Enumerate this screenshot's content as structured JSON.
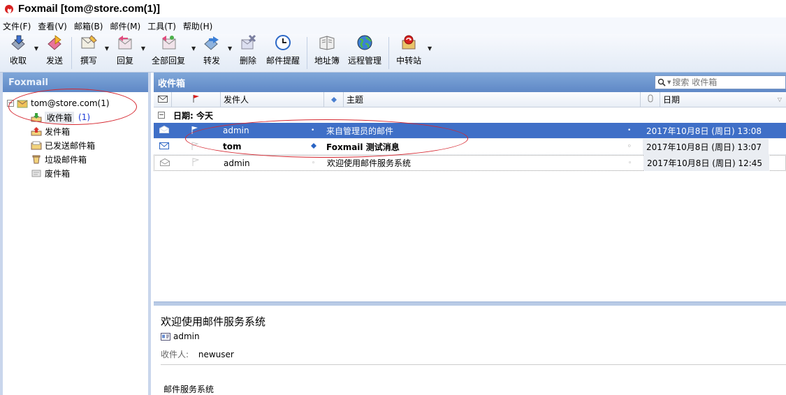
{
  "window": {
    "title": "Foxmail [tom@store.com(1)]"
  },
  "menu": [
    "文件(F)",
    "查看(V)",
    "邮箱(B)",
    "邮件(M)",
    "工具(T)",
    "帮助(H)"
  ],
  "toolbar": {
    "receive": "收取",
    "send": "发送",
    "compose": "撰写",
    "reply": "回复",
    "reply_all": "全部回复",
    "forward": "转发",
    "delete": "删除",
    "reminder": "邮件提醒",
    "address_book": "地址簿",
    "remote_manage": "远程管理",
    "relay": "中转站"
  },
  "sidebar": {
    "header": "Foxmail",
    "account": "tom@store.com(1)",
    "folders": [
      {
        "label": "收件箱",
        "count": "(1)"
      },
      {
        "label": "发件箱",
        "count": ""
      },
      {
        "label": "已发送邮件箱",
        "count": ""
      },
      {
        "label": "垃圾邮件箱",
        "count": ""
      },
      {
        "label": "废件箱",
        "count": ""
      }
    ]
  },
  "mail_list": {
    "folder_title": "收件箱",
    "search_placeholder": "搜索 收件箱",
    "columns": {
      "from": "发件人",
      "subject": "主题",
      "date": "日期"
    },
    "group_label": "日期: 今天",
    "rows": [
      {
        "from": "admin",
        "subject": "来自管理员的邮件",
        "date": "2017年10月8日 (周日) 13:08",
        "selected": true,
        "unread": false
      },
      {
        "from": "tom",
        "subject": "Foxmail 测试消息",
        "date": "2017年10月8日 (周日) 13:07",
        "selected": false,
        "unread": true
      },
      {
        "from": "admin",
        "subject": "欢迎使用邮件服务系统",
        "date": "2017年10月8日 (周日) 12:45",
        "selected": false,
        "unread": false
      }
    ]
  },
  "preview": {
    "subject": "欢迎使用邮件服务系统",
    "from": "admin",
    "to_label": "收件人:",
    "to": "newuser",
    "body": "邮件服务系统"
  },
  "colors": {
    "selection": "#3f6fc7",
    "panel_header": "#6b93cf",
    "annotation": "#d6262f"
  }
}
